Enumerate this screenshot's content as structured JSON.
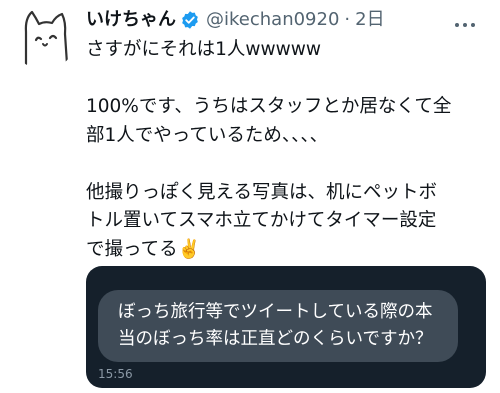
{
  "tweet": {
    "author_name": "いけちゃん",
    "author_handle": "@ikechan0920",
    "separator": "·",
    "timestamp": "2日",
    "more_icon": "more-dots-icon",
    "verified_color": "#1d9bf0",
    "lines": [
      "さすがにそれは1人wwwww",
      "",
      "100%です、うちはスタッフとか居なくて全",
      "部1人でやっているため、、、、",
      "",
      "他撮りっぽく見える写真は、机にペットボ",
      "トル置いてスマホ立てかけてタイマー設定",
      "で撮ってる✌️"
    ]
  },
  "quoted_image": {
    "message_lines": [
      "ぼっち旅行等でツイートしている際の本",
      "当のぼっち率は正直どのくらいですか？"
    ],
    "time": "15:56"
  }
}
